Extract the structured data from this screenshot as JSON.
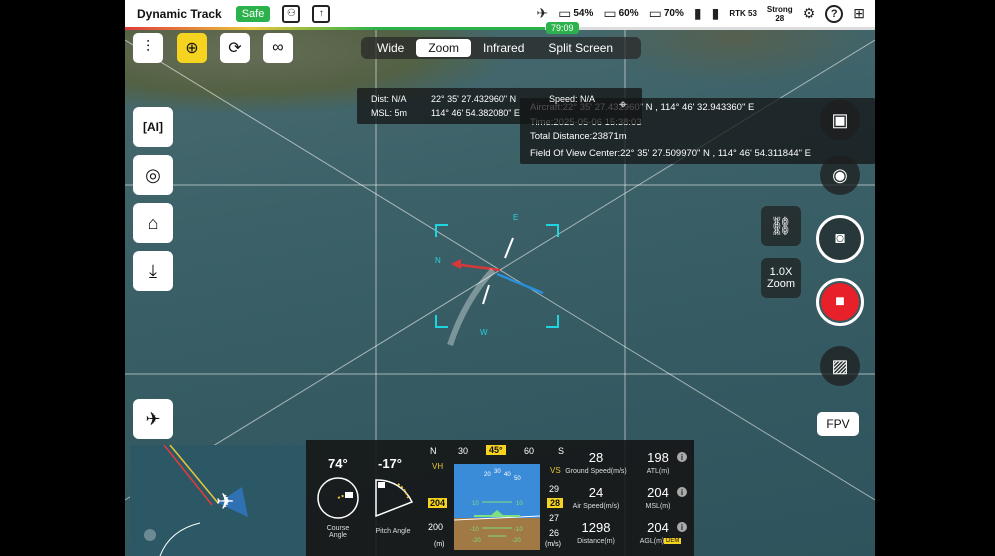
{
  "status_bar": {
    "title": "Dynamic Track",
    "status_badge": "Safe",
    "battery_1": "54%",
    "battery_2": "60%",
    "battery_3": "70%",
    "rtk_label": "RTK",
    "rtk_count": "53",
    "signal_strength": "Strong",
    "signal_count": "28",
    "flight_time": "79:09"
  },
  "mode_tabs": [
    {
      "label": "Wide",
      "selected": false
    },
    {
      "label": "Zoom",
      "selected": true
    },
    {
      "label": "Infrared",
      "selected": false
    },
    {
      "label": "Split Screen",
      "selected": false
    }
  ],
  "position_panel": {
    "dist": "Dist: N/A",
    "msl": "MSL: 5m",
    "lat": "22° 35' 27.432960\" N",
    "lon": "114° 46' 54.382080\" E",
    "speed": "Speed: N/A"
  },
  "route_panel": {
    "aircraft": "Aircraft:22° 35' 27.432960\" N , 114° 46' 32.943360\" E",
    "time": "Time:2025-05-06 15:38:03",
    "total_distance": "Total Distance:23871m",
    "fov_center": "Field Of View Center:22° 35' 27.509970\" N , 114° 46' 54.311844\" E"
  },
  "compass": {
    "n": "N",
    "e": "E",
    "w": "W"
  },
  "zoom": {
    "value": "1.0X",
    "label": "Zoom"
  },
  "fpv_label": "FPV",
  "gimbal": {
    "course_value": "74°",
    "course_label": "Course Angle",
    "pitch_value": "-17°",
    "pitch_label": "Pitch Angle"
  },
  "heading_tape": [
    "N",
    "30",
    "45°",
    "60",
    "S"
  ],
  "vh_label": "VH",
  "vs_label": "VS",
  "left_tape": [
    "204",
    "200",
    "(m)"
  ],
  "right_tape": [
    "29",
    "28",
    "27",
    "26",
    "(m/s)"
  ],
  "horizon_ticks": [
    "20",
    "30",
    "40",
    "50",
    "10",
    "10",
    "-10",
    "-10",
    "-20",
    "-20"
  ],
  "metrics": {
    "ground_speed": {
      "value": "28",
      "label": "Ground Speed(m/s)"
    },
    "air_speed": {
      "value": "24",
      "label": "Air Speed(m/s)"
    },
    "distance": {
      "value": "1298",
      "label": "Distance(m)"
    },
    "atl": {
      "value": "198",
      "label": "ATL(m)"
    },
    "msl": {
      "value": "204",
      "label": "MSL(m)"
    },
    "agl": {
      "value": "204",
      "label": "AGL(m)",
      "badge": "DEM"
    }
  },
  "icons": {
    "info": "i"
  }
}
